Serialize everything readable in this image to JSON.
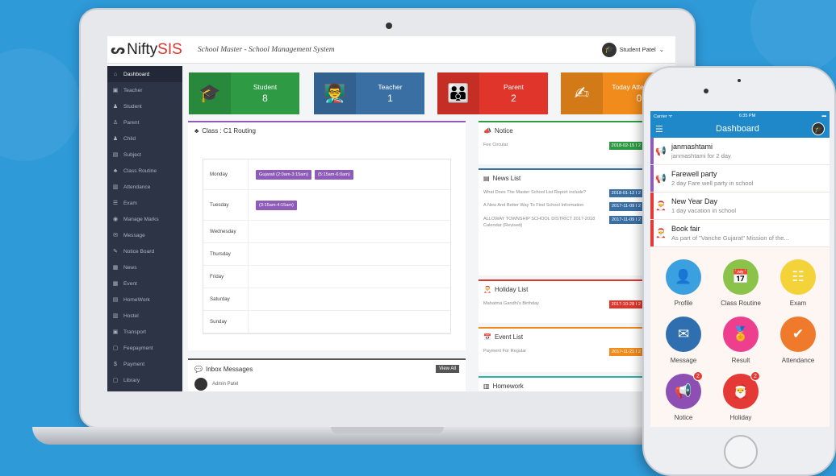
{
  "app": {
    "logo_prefix": "Nifty",
    "logo_suffix": "SIS",
    "header_title": "School Master - School Management System",
    "user_name": "Student Patel",
    "user_caret": "⌄"
  },
  "sidebar": {
    "items": [
      {
        "label": "Dashboard",
        "icon": "⌂",
        "active": true
      },
      {
        "label": "Teacher",
        "icon": "▣"
      },
      {
        "label": "Student",
        "icon": "♟"
      },
      {
        "label": "Parent",
        "icon": "♙"
      },
      {
        "label": "Child",
        "icon": "♟"
      },
      {
        "label": "Subject",
        "icon": "▤"
      },
      {
        "label": "Class Routine",
        "icon": "♣"
      },
      {
        "label": "Attendance",
        "icon": "▥"
      },
      {
        "label": "Exam",
        "icon": "☰"
      },
      {
        "label": "Manage Marks",
        "icon": "◉"
      },
      {
        "label": "Message",
        "icon": "✉"
      },
      {
        "label": "Notice Board",
        "icon": "✎"
      },
      {
        "label": "News",
        "icon": "▦"
      },
      {
        "label": "Event",
        "icon": "▦"
      },
      {
        "label": "HomeWork",
        "icon": "▤"
      },
      {
        "label": "Hostel",
        "icon": "▥"
      },
      {
        "label": "Transport",
        "icon": "▣"
      },
      {
        "label": "Feepayment",
        "icon": "▢"
      },
      {
        "label": "Payment",
        "icon": "$"
      },
      {
        "label": "Library",
        "icon": "▢"
      }
    ]
  },
  "stats": [
    {
      "label": "Student",
      "value": "8",
      "color": "#2e9b44",
      "icon": "🎓"
    },
    {
      "label": "Teacher",
      "value": "1",
      "color": "#3a6fa3",
      "icon": "👨‍🏫"
    },
    {
      "label": "Parent",
      "value": "2",
      "color": "#e0352b",
      "icon": "👪"
    },
    {
      "label": "Today Attendance",
      "value": "0",
      "color": "#f08b1c",
      "icon": "✍"
    }
  ],
  "routine": {
    "title": "Class : C1 Routing",
    "days": [
      {
        "day": "Monday",
        "slots": [
          "Gujarati (2:0am-3:15am)",
          "(5:15am-6:0am)"
        ]
      },
      {
        "day": "Tuesday",
        "slots": [
          "(3:15am-4:15am)"
        ]
      },
      {
        "day": "Wednesday",
        "slots": []
      },
      {
        "day": "Thursday",
        "slots": []
      },
      {
        "day": "Friday",
        "slots": []
      },
      {
        "day": "Saturday",
        "slots": []
      },
      {
        "day": "Sunday",
        "slots": []
      }
    ]
  },
  "inbox": {
    "title": "Inbox Messages",
    "view_all": "View All",
    "first_sender": "Admin Patel"
  },
  "notice": {
    "title": "Notice",
    "items": [
      {
        "text": "Fee Circular",
        "date": "2018-02-15 I 2"
      }
    ]
  },
  "news": {
    "title": "News List",
    "items": [
      {
        "text": "What Does The Master School List Report include?",
        "date": "2018-01-12 I 2"
      },
      {
        "text": "A New And Better Way To Find School Information",
        "date": "2017-11-09 I 2"
      },
      {
        "text": "ALLOWAY TOWNSHIP SCHOOL DISTRICT 2017-2018 Calendar (Revised)",
        "date": "2017-11-09 I 2"
      }
    ]
  },
  "holiday": {
    "title": "Holiday List",
    "items": [
      {
        "text": "Mahatma Gandhi's Birthday",
        "date": "2017-10-28 I 2"
      }
    ]
  },
  "event": {
    "title": "Event List",
    "items": [
      {
        "text": "Payment For Regular",
        "date": "2017-11-21 I 2"
      }
    ]
  },
  "homework": {
    "title": "Homework"
  },
  "phone": {
    "carrier": "Carrier ᯤ",
    "time": "6:35 PM",
    "battery": "▬",
    "title": "Dashboard",
    "notifications": [
      {
        "title": "janmashtami",
        "sub": "janmashtami for 2 day",
        "color": "#8e5bb8",
        "icon": "📢"
      },
      {
        "title": "Farewell party",
        "sub": "2 day Fare well party in school",
        "color": "#8e5bb8",
        "icon": "📢"
      },
      {
        "title": "New Year Day",
        "sub": "1 day vacation in school",
        "color": "#e53935",
        "icon": "🎅"
      },
      {
        "title": "Book fair",
        "sub": "As part of \"Vanche Gujarat\" Mission of the...",
        "color": "#e53935",
        "icon": "🎅"
      }
    ],
    "tiles": [
      {
        "label": "Profile",
        "color": "#3aa0e0",
        "icon": "👤",
        "badge": ""
      },
      {
        "label": "Class Routine",
        "color": "#8bc34a",
        "icon": "📅",
        "badge": ""
      },
      {
        "label": "Exam",
        "color": "#f4d33a",
        "icon": "☷",
        "badge": ""
      },
      {
        "label": "Message",
        "color": "#2f6fb0",
        "icon": "✉",
        "badge": ""
      },
      {
        "label": "Result",
        "color": "#ee3f8f",
        "icon": "🏅",
        "badge": ""
      },
      {
        "label": "Attendance",
        "color": "#f07a2b",
        "icon": "✔",
        "badge": ""
      },
      {
        "label": "Notice",
        "color": "#8e4fb5",
        "icon": "📢",
        "badge": "2"
      },
      {
        "label": "Holiday",
        "color": "#e53935",
        "icon": "🎅",
        "badge": "2"
      }
    ]
  }
}
